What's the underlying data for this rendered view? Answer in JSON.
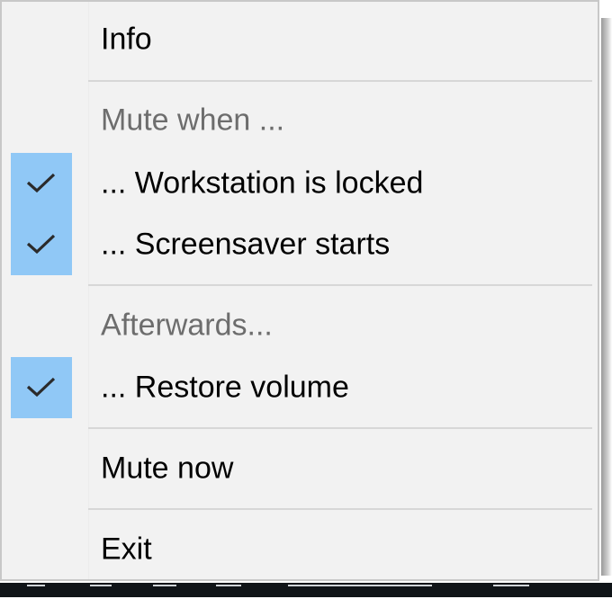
{
  "menu": {
    "items": [
      {
        "label": "Info",
        "type": "command",
        "enabled": true
      },
      {
        "type": "separator"
      },
      {
        "label": "Mute when ...",
        "type": "header",
        "enabled": false
      },
      {
        "label": "... Workstation is locked",
        "type": "checkbox",
        "checked": true,
        "icon": "checkmark-icon"
      },
      {
        "label": "... Screensaver starts",
        "type": "checkbox",
        "checked": true,
        "icon": "checkmark-icon"
      },
      {
        "type": "separator"
      },
      {
        "label": "Afterwards...",
        "type": "header",
        "enabled": false
      },
      {
        "label": "... Restore volume",
        "type": "checkbox",
        "checked": true,
        "icon": "checkmark-icon"
      },
      {
        "type": "separator"
      },
      {
        "label": "Mute now",
        "type": "command",
        "enabled": true
      },
      {
        "type": "separator"
      },
      {
        "label": "Exit",
        "type": "command",
        "enabled": true
      }
    ]
  },
  "colors": {
    "menu_background": "#f2f2f2",
    "check_highlight": "#90c8f6",
    "disabled_text": "#6d6d6d",
    "separator": "#d7d7d7"
  }
}
